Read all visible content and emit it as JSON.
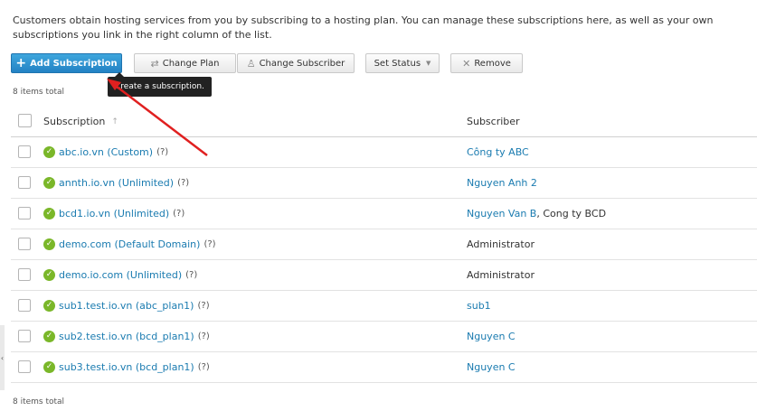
{
  "intro_text": "Customers obtain hosting services from you by subscribing to a hosting plan. You can manage these subscriptions here, as well as your own subscriptions you link in the right column of the list.",
  "toolbar": {
    "add_label": "Add Subscription",
    "change_plan_label": "Change Plan",
    "change_subscriber_label": "Change Subscriber",
    "set_status_label": "Set Status",
    "remove_label": "Remove"
  },
  "tooltip": "Create a subscription.",
  "items_total": "8 items total",
  "table": {
    "col_subscription": "Subscription",
    "col_subscriber": "Subscriber",
    "rows": [
      {
        "subscription": "abc.io.vn (Custom)",
        "help": "(?)",
        "subscriber": "Công ty ABC",
        "extra": ""
      },
      {
        "subscription": "annth.io.vn (Unlimited)",
        "help": "(?)",
        "subscriber": "Nguyen Anh 2",
        "extra": ""
      },
      {
        "subscription": "bcd1.io.vn (Unlimited)",
        "help": "(?)",
        "subscriber": "Nguyen Van B",
        "extra": ", Cong ty BCD"
      },
      {
        "subscription": "demo.com (Default Domain)",
        "help": "(?)",
        "subscriber": "Administrator",
        "extra": ""
      },
      {
        "subscription": "demo.io.com (Unlimited)",
        "help": "(?)",
        "subscriber": "Administrator",
        "extra": ""
      },
      {
        "subscription": "sub1.test.io.vn (abc_plan1)",
        "help": "(?)",
        "subscriber": "sub1",
        "extra": ""
      },
      {
        "subscription": "sub2.test.io.vn (bcd_plan1)",
        "help": "(?)",
        "subscriber": "Nguyen C",
        "extra": ""
      },
      {
        "subscription": "sub3.test.io.vn (bcd_plan1)",
        "help": "(?)",
        "subscriber": "Nguyen C",
        "extra": ""
      }
    ]
  },
  "colors": {
    "accent": "#2382c4",
    "link": "#1a7bb0",
    "status_ok": "#7ab729",
    "annotation_arrow": "#e02020"
  }
}
